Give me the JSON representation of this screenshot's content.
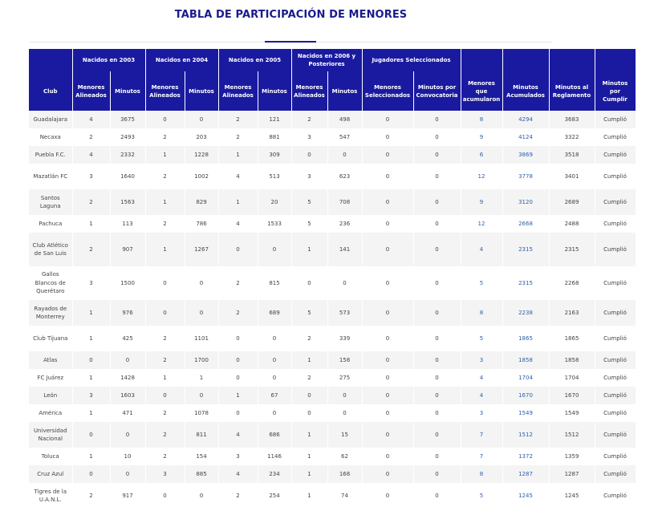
{
  "title": "TABLA DE PARTICIPACIÓN DE MENORES",
  "group_headers": [
    "",
    "Nacidos en 2003",
    "Nacidos en 2004",
    "Nacidos en 2005",
    "Nacidos en 2006 y Posteriores",
    "Jugadores Seleccionados",
    "",
    "",
    ""
  ],
  "columns": [
    "Club",
    "Menores Alineados",
    "Minutos",
    "Menores Alineados",
    "Minutos",
    "Menores Alineados",
    "Minutos",
    "Menores Alineados",
    "Minutos",
    "Menores Seleccionados",
    "Minutos por Convocatoria",
    "Menores que acumularon",
    "Minutos Acumulados",
    "Minutos al Reglamento",
    "Minutos por Cumplir"
  ],
  "rows": [
    [
      "Guadalajara",
      "4",
      "3675",
      "0",
      "0",
      "2",
      "121",
      "2",
      "498",
      "0",
      "0",
      "8",
      "4294",
      "3683",
      "Cumplió"
    ],
    [
      "Necaxa",
      "2",
      "2493",
      "2",
      "203",
      "2",
      "881",
      "3",
      "547",
      "0",
      "0",
      "9",
      "4124",
      "3322",
      "Cumplió"
    ],
    [
      "Puebla F.C.",
      "4",
      "2332",
      "1",
      "1228",
      "1",
      "309",
      "0",
      "0",
      "0",
      "0",
      "6",
      "3869",
      "3518",
      "Cumplió"
    ],
    [
      "Mazatlán FC",
      "3",
      "1640",
      "2",
      "1002",
      "4",
      "513",
      "3",
      "623",
      "0",
      "0",
      "12",
      "3778",
      "3401",
      "Cumplió"
    ],
    [
      "Santos Laguna",
      "2",
      "1563",
      "1",
      "829",
      "1",
      "20",
      "5",
      "708",
      "0",
      "0",
      "9",
      "3120",
      "2689",
      "Cumplió"
    ],
    [
      "Pachuca",
      "1",
      "113",
      "2",
      "786",
      "4",
      "1533",
      "5",
      "236",
      "0",
      "0",
      "12",
      "2668",
      "2488",
      "Cumplió"
    ],
    [
      "Club Atlético de San Luis",
      "2",
      "907",
      "1",
      "1267",
      "0",
      "0",
      "1",
      "141",
      "0",
      "0",
      "4",
      "2315",
      "2315",
      "Cumplió"
    ],
    [
      "Gallos Blancos de Querétaro",
      "3",
      "1500",
      "0",
      "0",
      "2",
      "815",
      "0",
      "0",
      "0",
      "0",
      "5",
      "2315",
      "2268",
      "Cumplió"
    ],
    [
      "Rayados de Monterrey",
      "1",
      "976",
      "0",
      "0",
      "2",
      "689",
      "5",
      "573",
      "0",
      "0",
      "8",
      "2238",
      "2163",
      "Cumplió"
    ],
    [
      "Club Tijuana",
      "1",
      "425",
      "2",
      "1101",
      "0",
      "0",
      "2",
      "339",
      "0",
      "0",
      "5",
      "1865",
      "1865",
      "Cumplió"
    ],
    [
      "Atlas",
      "0",
      "0",
      "2",
      "1700",
      "0",
      "0",
      "1",
      "158",
      "0",
      "0",
      "3",
      "1858",
      "1858",
      "Cumplió"
    ],
    [
      "FC Juárez",
      "1",
      "1428",
      "1",
      "1",
      "0",
      "0",
      "2",
      "275",
      "0",
      "0",
      "4",
      "1704",
      "1704",
      "Cumplió"
    ],
    [
      "León",
      "3",
      "1603",
      "0",
      "0",
      "1",
      "67",
      "0",
      "0",
      "0",
      "0",
      "4",
      "1670",
      "1670",
      "Cumplió"
    ],
    [
      "América",
      "1",
      "471",
      "2",
      "1078",
      "0",
      "0",
      "0",
      "0",
      "0",
      "0",
      "3",
      "1549",
      "1549",
      "Cumplió"
    ],
    [
      "Universidad Nacional",
      "0",
      "0",
      "2",
      "811",
      "4",
      "686",
      "1",
      "15",
      "0",
      "0",
      "7",
      "1512",
      "1512",
      "Cumplió"
    ],
    [
      "Toluca",
      "1",
      "10",
      "2",
      "154",
      "3",
      "1146",
      "1",
      "62",
      "0",
      "0",
      "7",
      "1372",
      "1359",
      "Cumplió"
    ],
    [
      "Cruz Azul",
      "0",
      "0",
      "3",
      "885",
      "4",
      "234",
      "1",
      "168",
      "0",
      "0",
      "8",
      "1287",
      "1287",
      "Cumplió"
    ],
    [
      "Tigres de la U.A.N.L.",
      "2",
      "917",
      "0",
      "0",
      "2",
      "254",
      "1",
      "74",
      "0",
      "0",
      "5",
      "1245",
      "1245",
      "Cumplió"
    ]
  ],
  "colors": {
    "header_bg": "#1a1aa0",
    "title": "#1b1b8c",
    "link": "#2e5fa8",
    "zebra": "#f4f4f4"
  }
}
